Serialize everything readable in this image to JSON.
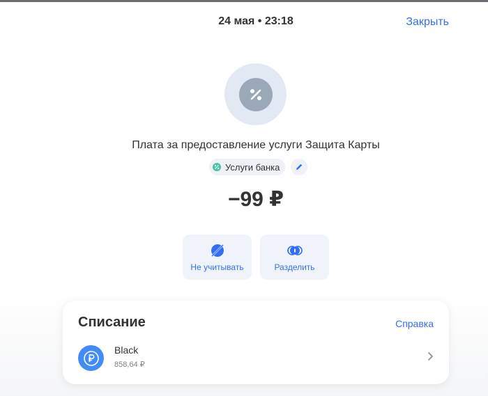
{
  "header": {
    "datetime": "24 мая • 23:18",
    "close_label": "Закрыть"
  },
  "operation": {
    "category_icon": "percent-icon",
    "title": "Плата за предоставление услуги Защита Карты",
    "category_label": "Услуги банка",
    "amount": "−99 ₽"
  },
  "actions": [
    {
      "label": "Не учитывать",
      "icon": "exclude-icon"
    },
    {
      "label": "Разделить",
      "icon": "split-icon"
    }
  ],
  "card": {
    "title": "Списание",
    "help_label": "Справка",
    "account": {
      "name": "Black",
      "balance": "858,64 ₽",
      "icon": "ruble-icon"
    }
  },
  "colors": {
    "accent": "#336fee",
    "category_green": "#42c6a5",
    "account_blue": "#428bf9"
  }
}
